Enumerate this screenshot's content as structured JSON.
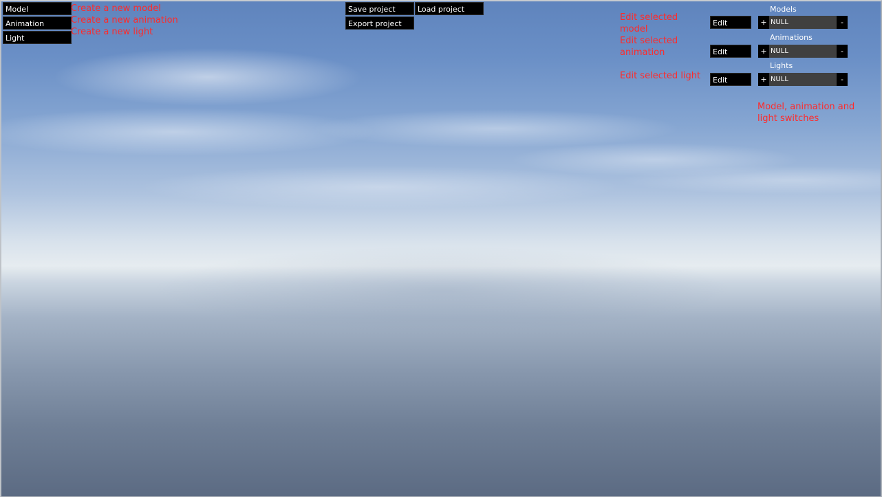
{
  "left_menu": {
    "model_btn": "Model",
    "animation_btn": "Animation",
    "light_btn": "Light"
  },
  "left_hints": {
    "model": "Create a new model",
    "animation": "Create a new animation",
    "light": "Create a new light"
  },
  "project": {
    "save_btn": "Save project",
    "load_btn": "Load project",
    "export_btn": "Export project"
  },
  "edit_hints": {
    "model": "Edit selected model",
    "animation": "Edit selected animation",
    "light": "Edit selected light"
  },
  "edit_buttons": {
    "model": "Edit",
    "animation": "Edit",
    "light": "Edit"
  },
  "switches": {
    "models": {
      "label": "Models",
      "plus": "+",
      "value": "NULL",
      "minus": "-"
    },
    "animations": {
      "label": "Animations",
      "plus": "+",
      "value": "NULL",
      "minus": "-"
    },
    "lights": {
      "label": "Lights",
      "plus": "+",
      "value": "NULL",
      "minus": "-"
    }
  },
  "switches_hint": "Model, animation and light switches",
  "colors": {
    "hint": "#ff2a2a",
    "button_bg": "#000000",
    "value_bg": "#404040"
  }
}
